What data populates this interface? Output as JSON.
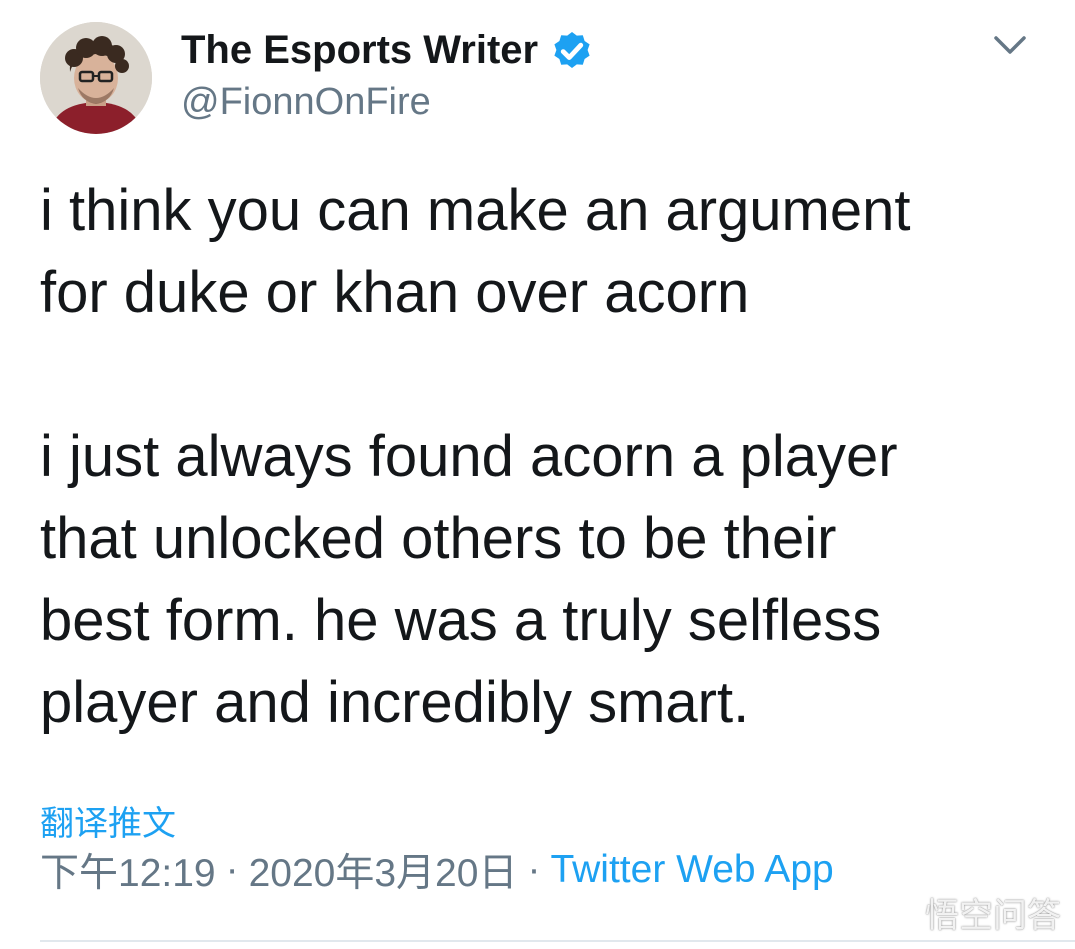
{
  "tweet": {
    "author": {
      "display_name": "The Esports Writer",
      "handle": "@FionnOnFire",
      "verified_icon": "verified-badge-icon",
      "avatar": "profile-photo"
    },
    "menu_icon": "chevron-down-icon",
    "paragraphs": [
      "i think you can make an argument\nfor duke or khan over acorn",
      "i just always found acorn a player\nthat unlocked others to be their\nbest form. he was a truly selfless\nplayer and incredibly smart."
    ],
    "translate_label": "翻译推文",
    "time": "下午12:19",
    "date": "2020年3月20日",
    "separator": "·",
    "source": "Twitter Web App"
  },
  "watermark": "悟空问答",
  "colors": {
    "text": "#14171a",
    "secondary": "#657786",
    "link": "#1da1f2",
    "verified": "#1da1f2"
  }
}
